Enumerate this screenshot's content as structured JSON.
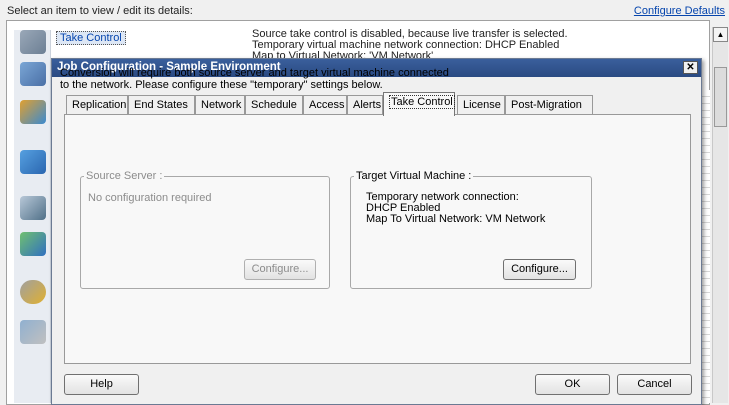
{
  "background": {
    "header_text": "Select an item to view / edit its details:",
    "configure_defaults_link": "Configure Defaults",
    "selected_item": "Take Control",
    "info_text": "Source take control is disabled, because live transfer is selected.\nTemporary virtual machine network connection: DHCP Enabled\nMap to Virtual Network: 'VM Network'",
    "scroll_up_glyph": "▲"
  },
  "dialog": {
    "title": "Job Configuration - Sample Environment",
    "close_glyph": "✕",
    "tabs": [
      {
        "label": "Replication"
      },
      {
        "label": "End States"
      },
      {
        "label": "Network"
      },
      {
        "label": "Schedule"
      },
      {
        "label": "Access"
      },
      {
        "label": "Alerts"
      },
      {
        "label": "Take Control"
      },
      {
        "label": "License"
      },
      {
        "label": "Post-Migration"
      }
    ],
    "active_tab": "Take Control",
    "intro_text_line1": "Conversion will require both source server and target virtual machine connected",
    "intro_text_line2": "to the network.  Please configure these \"temporary\" settings below.",
    "source": {
      "legend": "Source Server :",
      "message": "No configuration required",
      "configure_label": "Configure..."
    },
    "target": {
      "legend": "Target Virtual Machine :",
      "details": "Temporary network connection:\nDHCP Enabled\nMap To Virtual Network: VM Network",
      "configure_label": "Configure..."
    },
    "help_label": "Help",
    "ok_label": "OK",
    "cancel_label": "Cancel"
  },
  "icons": {
    "sidebar": [
      "wrench-icon",
      "job-icon",
      "network-icon",
      "server-icon",
      "monitor-icon",
      "gear-icon",
      "component-icon",
      "cloud-icon"
    ]
  },
  "colors": {
    "titlebar": "#2f5290",
    "link": "#0645ad"
  }
}
